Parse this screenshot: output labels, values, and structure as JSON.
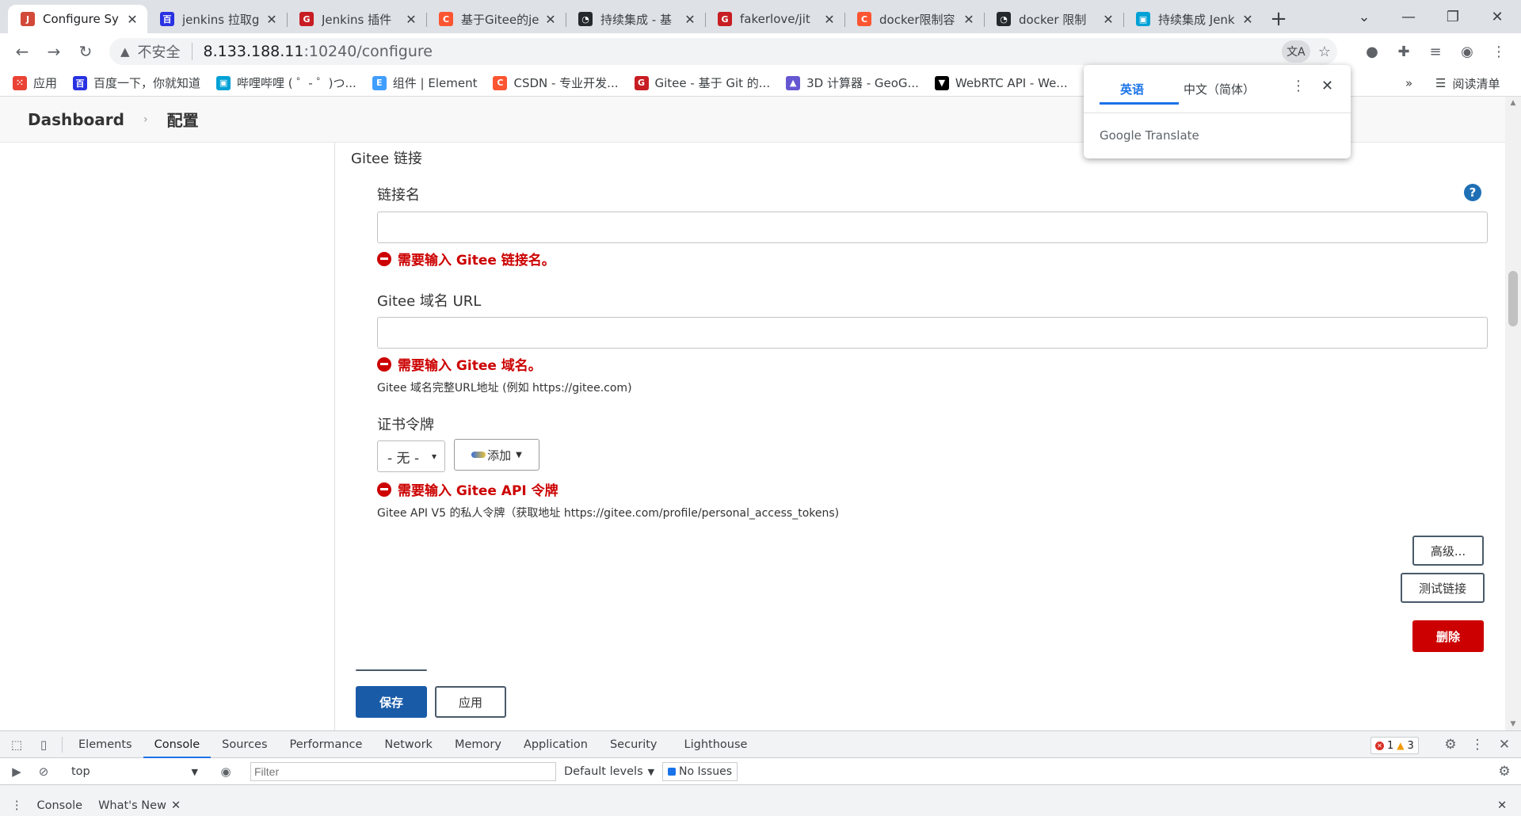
{
  "browser": {
    "tabs": [
      {
        "title": "Configure Sy",
        "icon": "jenkins-icon",
        "color": "#d24939",
        "active": true
      },
      {
        "title": "jenkins 拉取g",
        "icon": "baidu-icon",
        "color": "#2932e1"
      },
      {
        "title": "Jenkins 插件",
        "icon": "gitee-icon",
        "color": "#c71d23"
      },
      {
        "title": "基于Gitee的je",
        "icon": "csdn-icon",
        "color": "#fc5531"
      },
      {
        "title": "持续集成 - 基",
        "icon": "github-icon",
        "color": "#24292e"
      },
      {
        "title": "fakerlove/jit",
        "icon": "gitee-icon",
        "color": "#c71d23"
      },
      {
        "title": "docker限制容",
        "icon": "csdn-icon",
        "color": "#fc5531"
      },
      {
        "title": "docker 限制",
        "icon": "github-icon",
        "color": "#24292e"
      },
      {
        "title": "持续集成 Jenk",
        "icon": "bilibili-icon",
        "color": "#00a1d6"
      }
    ],
    "new_tab": "+",
    "address": {
      "insecure_label": "不安全",
      "host": "8.133.188.11",
      "path": ":10240/configure"
    },
    "bookmarks": [
      {
        "label": "应用",
        "icon": "apps-grid-icon",
        "color": "#ea4335"
      },
      {
        "label": "百度一下，你就知道",
        "icon": "baidu-icon",
        "color": "#2932e1"
      },
      {
        "label": "哔哩哔哩 ( ゜- ゜)つ...",
        "icon": "bilibili-icon",
        "color": "#00a1d6"
      },
      {
        "label": "组件 | Element",
        "icon": "element-icon",
        "color": "#409eff"
      },
      {
        "label": "CSDN - 专业开发...",
        "icon": "csdn-icon",
        "color": "#fc5531"
      },
      {
        "label": "Gitee - 基于 Git 的...",
        "icon": "gitee-icon",
        "color": "#c71d23"
      },
      {
        "label": "3D 计算器 - GeoG...",
        "icon": "geogebra-icon",
        "color": "#6557d2"
      },
      {
        "label": "WebRTC API - We...",
        "icon": "mdn-icon",
        "color": "#000000"
      }
    ],
    "bookmarks_overflow": "»",
    "reading_list": "阅读清单"
  },
  "translate_popup": {
    "source_lang": "英语",
    "target_lang": "中文（简体）",
    "brand": "Google Translate"
  },
  "jenkins": {
    "breadcrumb": [
      "Dashboard",
      "配置"
    ],
    "section_title": "Gitee 链接",
    "fields": {
      "connection_name": {
        "label": "链接名",
        "value": "",
        "error": "需要输入 Gitee 链接名。"
      },
      "domain_url": {
        "label": "Gitee 域名 URL",
        "value": "",
        "error": "需要输入 Gitee 域名。",
        "description": "Gitee 域名完整URL地址 (例如 https://gitee.com)"
      },
      "credential": {
        "label": "证书令牌",
        "selected": "- 无 -",
        "add_label": "添加",
        "error": "需要输入 Gitee API 令牌",
        "description": "Gitee API V5 的私人令牌（获取地址 https://gitee.com/profile/personal_access_tokens)"
      }
    },
    "buttons": {
      "advanced": "高级...",
      "test_connection": "测试链接",
      "delete": "删除",
      "save": "保存",
      "apply": "应用"
    },
    "help_icon": "?"
  },
  "devtools": {
    "tabs": [
      "Elements",
      "Console",
      "Sources",
      "Performance",
      "Network",
      "Memory",
      "Application",
      "Security",
      "Lighthouse"
    ],
    "active_tab": "Console",
    "errors": "1",
    "warnings": "3",
    "context": "top",
    "filter_placeholder": "Filter",
    "levels": "Default levels",
    "issues": "No Issues",
    "drawer_tabs": [
      "Console",
      "What's New"
    ]
  }
}
